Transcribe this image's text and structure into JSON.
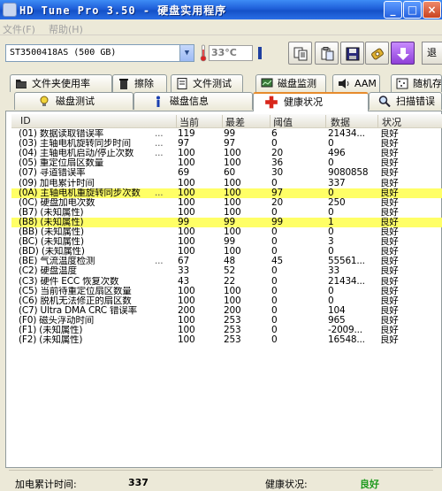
{
  "window": {
    "title": "HD Tune Pro 3.50 - 硬盘实用程序",
    "minimize": "_",
    "maximize": "□",
    "close": "×"
  },
  "menu": {
    "file": "文件(F)",
    "help": "帮助(H)"
  },
  "toolbar": {
    "drive": "ST3500418AS (500 GB)",
    "temperature": "33°C",
    "exit": "退"
  },
  "tabs_row1": [
    {
      "label": "文件夹使用率",
      "icon": "folder-icon"
    },
    {
      "label": "擦除",
      "icon": "trash-icon"
    },
    {
      "label": "文件测试",
      "icon": "file-icon"
    },
    {
      "label": "磁盘监测",
      "icon": "monitor-icon"
    },
    {
      "label": "AAM",
      "icon": "speaker-icon"
    },
    {
      "label": "随机存",
      "icon": "random-icon"
    }
  ],
  "tabs_row2": [
    {
      "label": "磁盘测试",
      "icon": "bulb-icon"
    },
    {
      "label": "磁盘信息",
      "icon": "info-icon"
    },
    {
      "label": "健康状况",
      "icon": "health-cross-icon"
    },
    {
      "label": "扫描错误",
      "icon": "magnifier-icon"
    }
  ],
  "table": {
    "headers": {
      "id": "ID",
      "current": "当前",
      "worst": "最差",
      "threshold": "阈值",
      "data": "数据",
      "status": "状况"
    },
    "rows": [
      {
        "id": "(01) 数据读取错误率",
        "current": "119",
        "worst": "99",
        "threshold": "6",
        "data": "21434...",
        "status": "良好",
        "dots": "...",
        "highlight": false
      },
      {
        "id": "(03) 主轴电机旋转同步时间",
        "current": "97",
        "worst": "97",
        "threshold": "0",
        "data": "0",
        "status": "良好",
        "dots": "...",
        "highlight": false
      },
      {
        "id": "(04) 主轴电机启动/停止次数",
        "current": "100",
        "worst": "100",
        "threshold": "20",
        "data": "496",
        "status": "良好",
        "dots": "...",
        "highlight": false
      },
      {
        "id": "(05) 重定位扇区数量",
        "current": "100",
        "worst": "100",
        "threshold": "36",
        "data": "0",
        "status": "良好",
        "dots": "",
        "highlight": false
      },
      {
        "id": "(07) 寻道错误率",
        "current": "69",
        "worst": "60",
        "threshold": "30",
        "data": "9080858",
        "status": "良好",
        "dots": "",
        "highlight": false
      },
      {
        "id": "(09) 加电累计时间",
        "current": "100",
        "worst": "100",
        "threshold": "0",
        "data": "337",
        "status": "良好",
        "dots": "",
        "highlight": false
      },
      {
        "id": "(0A) 主轴电机重旋转同步次数",
        "current": "100",
        "worst": "100",
        "threshold": "97",
        "data": "0",
        "status": "良好",
        "dots": "...",
        "highlight": true
      },
      {
        "id": "(0C) 硬盘加电次数",
        "current": "100",
        "worst": "100",
        "threshold": "20",
        "data": "250",
        "status": "良好",
        "dots": "",
        "highlight": false
      },
      {
        "id": "(B7) (未知属性)",
        "current": "100",
        "worst": "100",
        "threshold": "0",
        "data": "0",
        "status": "良好",
        "dots": "",
        "highlight": false
      },
      {
        "id": "(B8) (未知属性)",
        "current": "99",
        "worst": "99",
        "threshold": "99",
        "data": "1",
        "status": "良好",
        "dots": "",
        "highlight": true
      },
      {
        "id": "(BB) (未知属性)",
        "current": "100",
        "worst": "100",
        "threshold": "0",
        "data": "0",
        "status": "良好",
        "dots": "",
        "highlight": false
      },
      {
        "id": "(BC) (未知属性)",
        "current": "100",
        "worst": "99",
        "threshold": "0",
        "data": "3",
        "status": "良好",
        "dots": "",
        "highlight": false
      },
      {
        "id": "(BD) (未知属性)",
        "current": "100",
        "worst": "100",
        "threshold": "0",
        "data": "0",
        "status": "良好",
        "dots": "",
        "highlight": false
      },
      {
        "id": "(BE) 气流温度检测",
        "current": "67",
        "worst": "48",
        "threshold": "45",
        "data": "55561...",
        "status": "良好",
        "dots": "...",
        "highlight": false
      },
      {
        "id": "(C2) 硬盘温度",
        "current": "33",
        "worst": "52",
        "threshold": "0",
        "data": "33",
        "status": "良好",
        "dots": "",
        "highlight": false
      },
      {
        "id": "(C3) 硬件 ECC 恢复次数",
        "current": "43",
        "worst": "22",
        "threshold": "0",
        "data": "21434...",
        "status": "良好",
        "dots": "",
        "highlight": false
      },
      {
        "id": "(C5) 当前待重定位扇区数量",
        "current": "100",
        "worst": "100",
        "threshold": "0",
        "data": "0",
        "status": "良好",
        "dots": "",
        "highlight": false
      },
      {
        "id": "(C6) 脱机无法修正的扇区数",
        "current": "100",
        "worst": "100",
        "threshold": "0",
        "data": "0",
        "status": "良好",
        "dots": "",
        "highlight": false
      },
      {
        "id": "(C7) Ultra DMA CRC 错误率",
        "current": "200",
        "worst": "200",
        "threshold": "0",
        "data": "104",
        "status": "良好",
        "dots": "",
        "highlight": false
      },
      {
        "id": "(F0) 磁头浮动时间",
        "current": "100",
        "worst": "253",
        "threshold": "0",
        "data": "965",
        "status": "良好",
        "dots": "",
        "highlight": false
      },
      {
        "id": "(F1) (未知属性)",
        "current": "100",
        "worst": "253",
        "threshold": "0",
        "data": "-2009...",
        "status": "良好",
        "dots": "",
        "highlight": false
      },
      {
        "id": "(F2) (未知属性)",
        "current": "100",
        "worst": "253",
        "threshold": "0",
        "data": "16548...",
        "status": "良好",
        "dots": "",
        "highlight": false
      }
    ]
  },
  "status": {
    "poweron_label": "加电累计时间:",
    "poweron_value": "337",
    "health_label": "健康状况:",
    "health_value": "良好",
    "health_color": "#1e9a1e"
  },
  "colors": {
    "titlebar": "#1f5fd9",
    "highlight_row": "#ffff66",
    "active_tab_accent": "#e68b2c"
  }
}
